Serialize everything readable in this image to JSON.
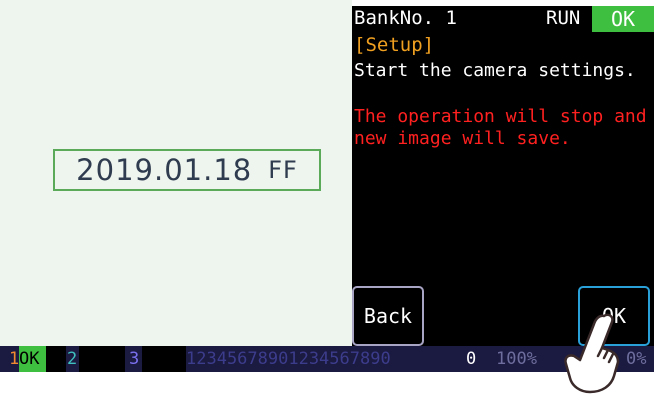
{
  "camera": {
    "date": "2019.01.18",
    "date_suffix": "FF"
  },
  "status": {
    "bank": "BankNo. 1",
    "run": "RUN",
    "ok": "OK"
  },
  "setup": {
    "title": "[Setup]",
    "message": "Start the camera settings.",
    "warning": "The operation will stop and new image will save."
  },
  "buttons": {
    "back": "Back",
    "ok": "OK"
  },
  "footer": {
    "slot1": "1",
    "slot1_status": "OK",
    "slot2": "2",
    "slot3": "3",
    "sequence": "12345678901234567890",
    "count": "0",
    "pct1": "100%",
    "pct2": "0%"
  },
  "colors": {
    "ok_green": "#3fbf3f",
    "warning_red": "#ff2020",
    "setup_orange": "#f0a020",
    "ok_button_border": "#2aa0d8"
  },
  "icons": {
    "pointer": "hand-pointer-icon"
  }
}
